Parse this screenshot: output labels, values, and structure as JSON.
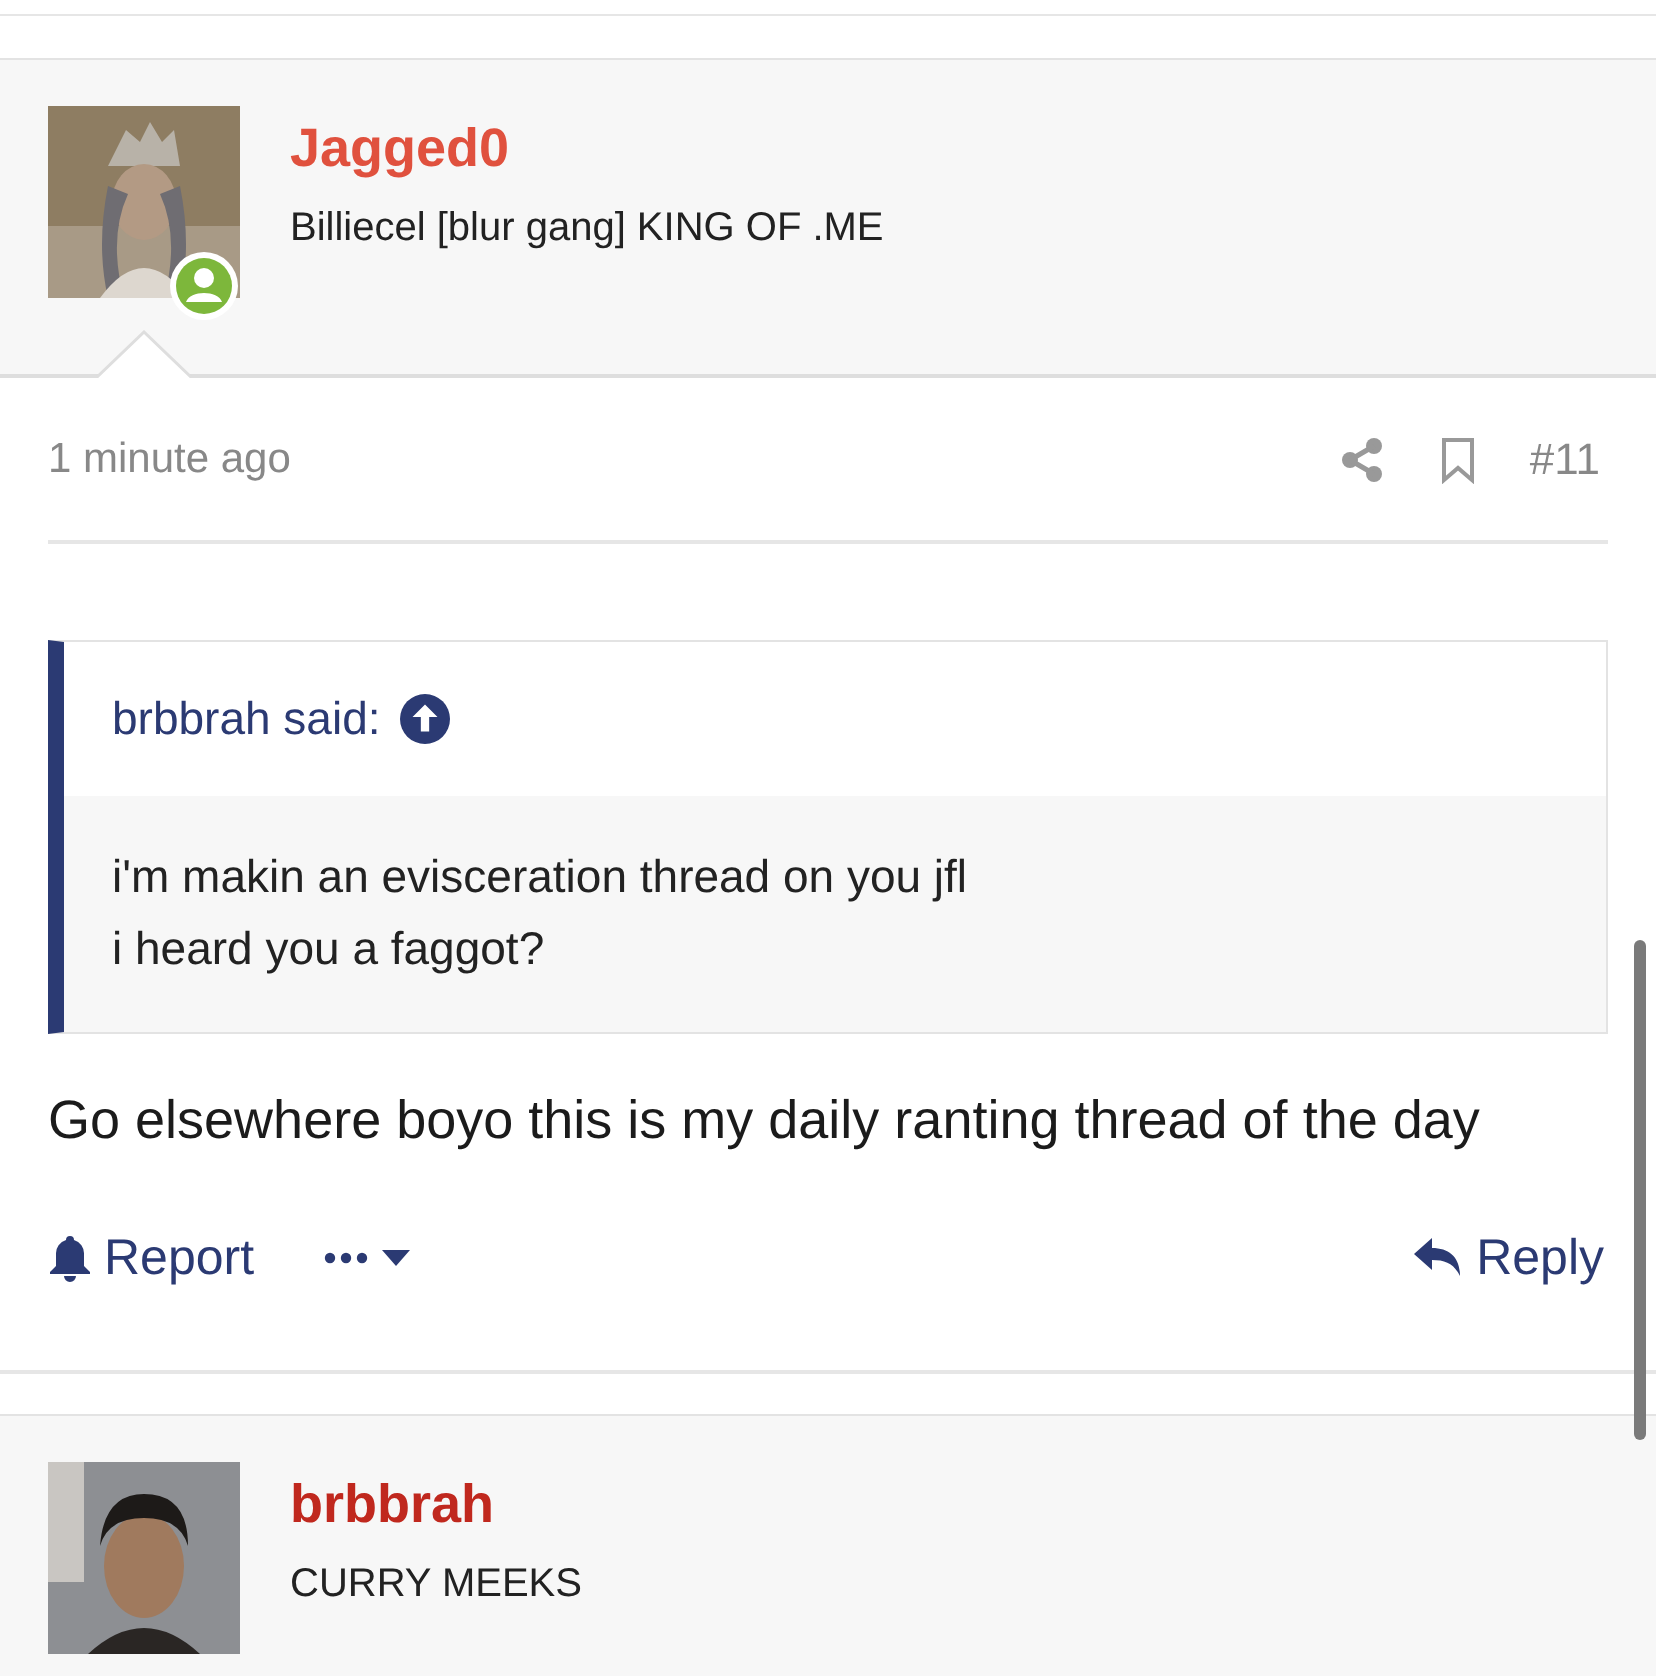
{
  "posts": [
    {
      "author": {
        "name": "Jagged0",
        "color": "#e0513e",
        "title": "Billiecel [blur gang] KING OF .ME",
        "online": true
      },
      "time": "1 minute ago",
      "number": "#11",
      "quote": {
        "author_line": "brbbrah said:",
        "lines": [
          "i'm makin an evisceration thread on you jfl",
          "i heard you a faggot?"
        ]
      },
      "message": "Go elsewhere boyo this is my daily ranting thread of the day",
      "actions": {
        "report": "Report",
        "reply": "Reply"
      }
    },
    {
      "author": {
        "name": "brbbrah",
        "color": "#c0281e",
        "title": "CURRY MEEKS"
      }
    }
  ]
}
